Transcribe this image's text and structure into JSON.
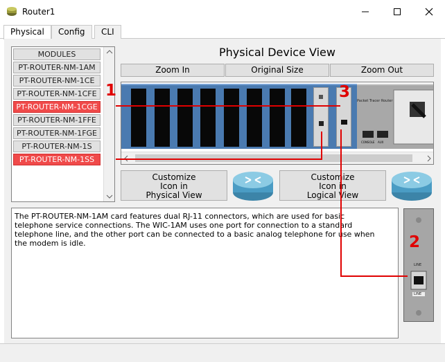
{
  "window": {
    "title": "Router1"
  },
  "tabs": [
    {
      "label": "Physical"
    },
    {
      "label": "Config"
    },
    {
      "label": "CLI"
    }
  ],
  "modules": {
    "header": "MODULES",
    "items": [
      {
        "label": "PT-ROUTER-NM-1AM",
        "highlighted": false
      },
      {
        "label": "PT-ROUTER-NM-1CE",
        "highlighted": false
      },
      {
        "label": "PT-ROUTER-NM-1CFE",
        "highlighted": false
      },
      {
        "label": "PT-ROUTER-NM-1CGE",
        "highlighted": true
      },
      {
        "label": "PT-ROUTER-NM-1FFE",
        "highlighted": false
      },
      {
        "label": "PT-ROUTER-NM-1FGE",
        "highlighted": false
      },
      {
        "label": "PT-ROUTER-NM-1S",
        "highlighted": false
      },
      {
        "label": "PT-ROUTER-NM-1SS",
        "highlighted": true
      }
    ]
  },
  "physical_view": {
    "title": "Physical Device View",
    "zoom_in": "Zoom In",
    "original_size": "Original Size",
    "zoom_out": "Zoom Out",
    "panel_label": "Packet Tracer Router",
    "console_label": "CONSOLE",
    "aux_label": "AUX"
  },
  "customize": {
    "physical": [
      "Customize",
      "Icon in",
      "Physical View"
    ],
    "logical": [
      "Customize",
      "Icon in",
      "Logical View"
    ]
  },
  "description": {
    "lines": [
      "The PT-ROUTER-NM-1AM card features dual RJ-11 connectors, which are used for basic",
      "telephone service connections. The WIC-1AM uses one port for connection to a standard",
      "telephone line, and the other port can be connected to a basic analog telephone for use when",
      "the modem is idle."
    ]
  },
  "module_detail": {
    "port_top_label": "LINE",
    "port_bottom_label": "LINE"
  },
  "callouts": [
    "1",
    "2",
    "3"
  ],
  "colors": {
    "highlight": "#f04a4a",
    "callout": "#e00000",
    "chassis": "#4a7ab0"
  }
}
